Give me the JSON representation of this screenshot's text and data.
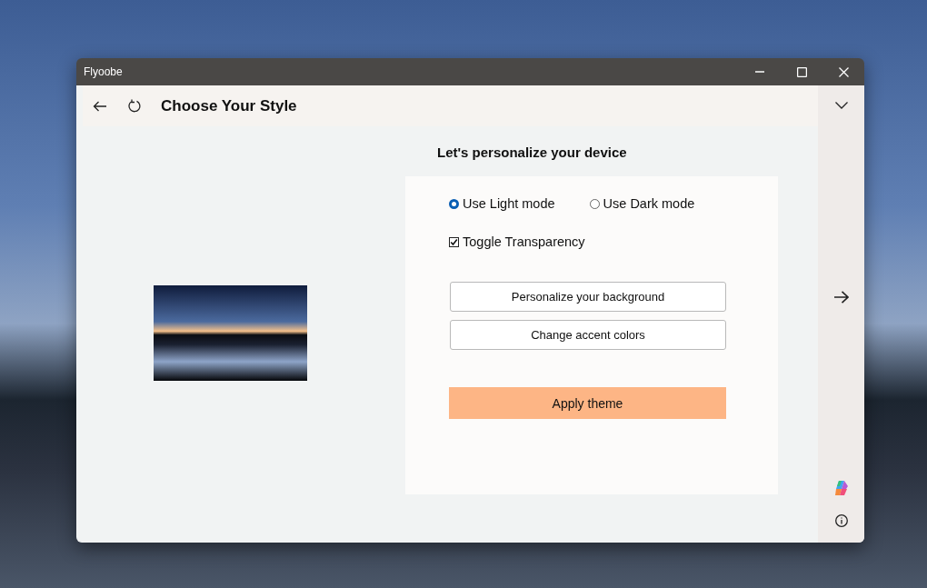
{
  "window": {
    "title": "Flyoobe"
  },
  "header": {
    "title": "Choose Your Style"
  },
  "content": {
    "heading": "Let's personalize your device",
    "modes": [
      {
        "label": "Use Light mode",
        "selected": true
      },
      {
        "label": "Use Dark mode",
        "selected": false
      }
    ],
    "transparency": {
      "label": "Toggle Transparency",
      "checked": true
    },
    "buttons": [
      "Personalize your background",
      "Change accent colors"
    ],
    "apply_button": "Apply theme"
  }
}
